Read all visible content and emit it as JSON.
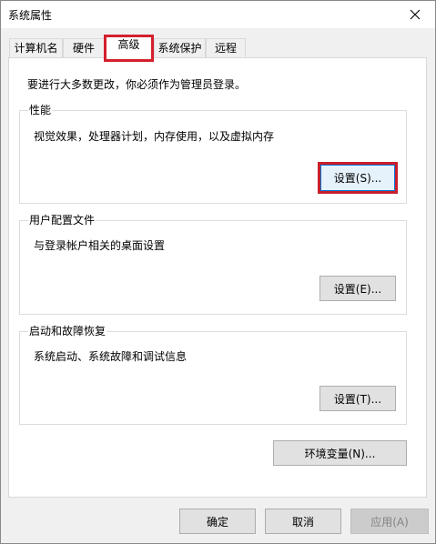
{
  "window": {
    "title": "系统属性"
  },
  "tabs": [
    {
      "label": "计算机名",
      "active": false
    },
    {
      "label": "硬件",
      "active": false
    },
    {
      "label": "高级",
      "active": true
    },
    {
      "label": "系统保护",
      "active": false
    },
    {
      "label": "远程",
      "active": false
    }
  ],
  "intro": "要进行大多数更改，你必须作为管理员登录。",
  "groups": {
    "performance": {
      "title": "性能",
      "description": "视觉效果，处理器计划，内存使用，以及虚拟内存",
      "button": "设置(S)..."
    },
    "user_profiles": {
      "title": "用户配置文件",
      "description": "与登录帐户相关的桌面设置",
      "button": "设置(E)..."
    },
    "startup_recovery": {
      "title": "启动和故障恢复",
      "description": "系统启动、系统故障和调试信息",
      "button": "设置(T)..."
    }
  },
  "env_button": "环境变量(N)...",
  "footer": {
    "ok": "确定",
    "cancel": "取消",
    "apply": "应用(A)"
  },
  "colors": {
    "highlight": "#d4202c",
    "focus": "#0078d7"
  },
  "icons": {
    "close": "close-icon"
  }
}
